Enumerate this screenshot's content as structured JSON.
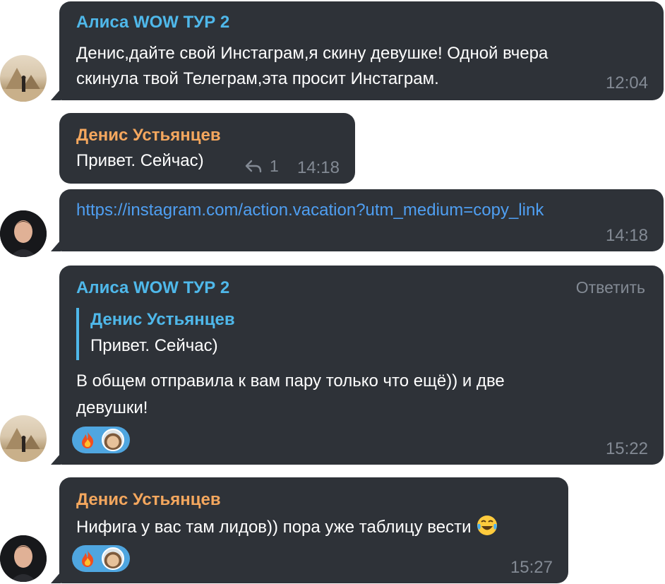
{
  "messages": [
    {
      "sender": "Алиса WOW ТУР 2",
      "lines": [
        "Денис,дайте свой Инстаграм,я скину девушке! Одной вчера",
        "скинула твой Телеграм,эта просит Инстаграм."
      ],
      "time": "12:04"
    },
    {
      "sender": "Денис Устьянцев",
      "text": "Привет. Сейчас)",
      "reply_count": "1",
      "time": "14:18"
    },
    {
      "link": "https://instagram.com/action.vacation?utm_medium=copy_link",
      "time": "14:18"
    },
    {
      "sender": "Алиса WOW ТУР 2",
      "reply_label": "Ответить",
      "quote": {
        "sender": "Денис Устьянцев",
        "text": "Привет. Сейчас)"
      },
      "lines": [
        "В общем отправила к вам пару только что ещё)) и две",
        "девушки!"
      ],
      "reactions": [
        "fire-emoji",
        "reactor-avatar"
      ],
      "time": "15:22"
    },
    {
      "sender": "Денис Устьянцев",
      "text": "Нифига у вас там лидов)) пора уже таблицу вести",
      "reactions": [
        "fire-emoji",
        "reactor-avatar"
      ],
      "time": "15:27"
    }
  ],
  "icons": {
    "reply": "reply-arrow-icon",
    "fire": "fire-icon",
    "laugh": "laughing-tears-emoji"
  },
  "colors": {
    "bubble": "#2e3238",
    "sender_blue": "#4fb8ea",
    "sender_orange": "#f4a75e",
    "link": "#4f9ff2",
    "time": "#838a94",
    "reaction": "#4fa6e0"
  }
}
